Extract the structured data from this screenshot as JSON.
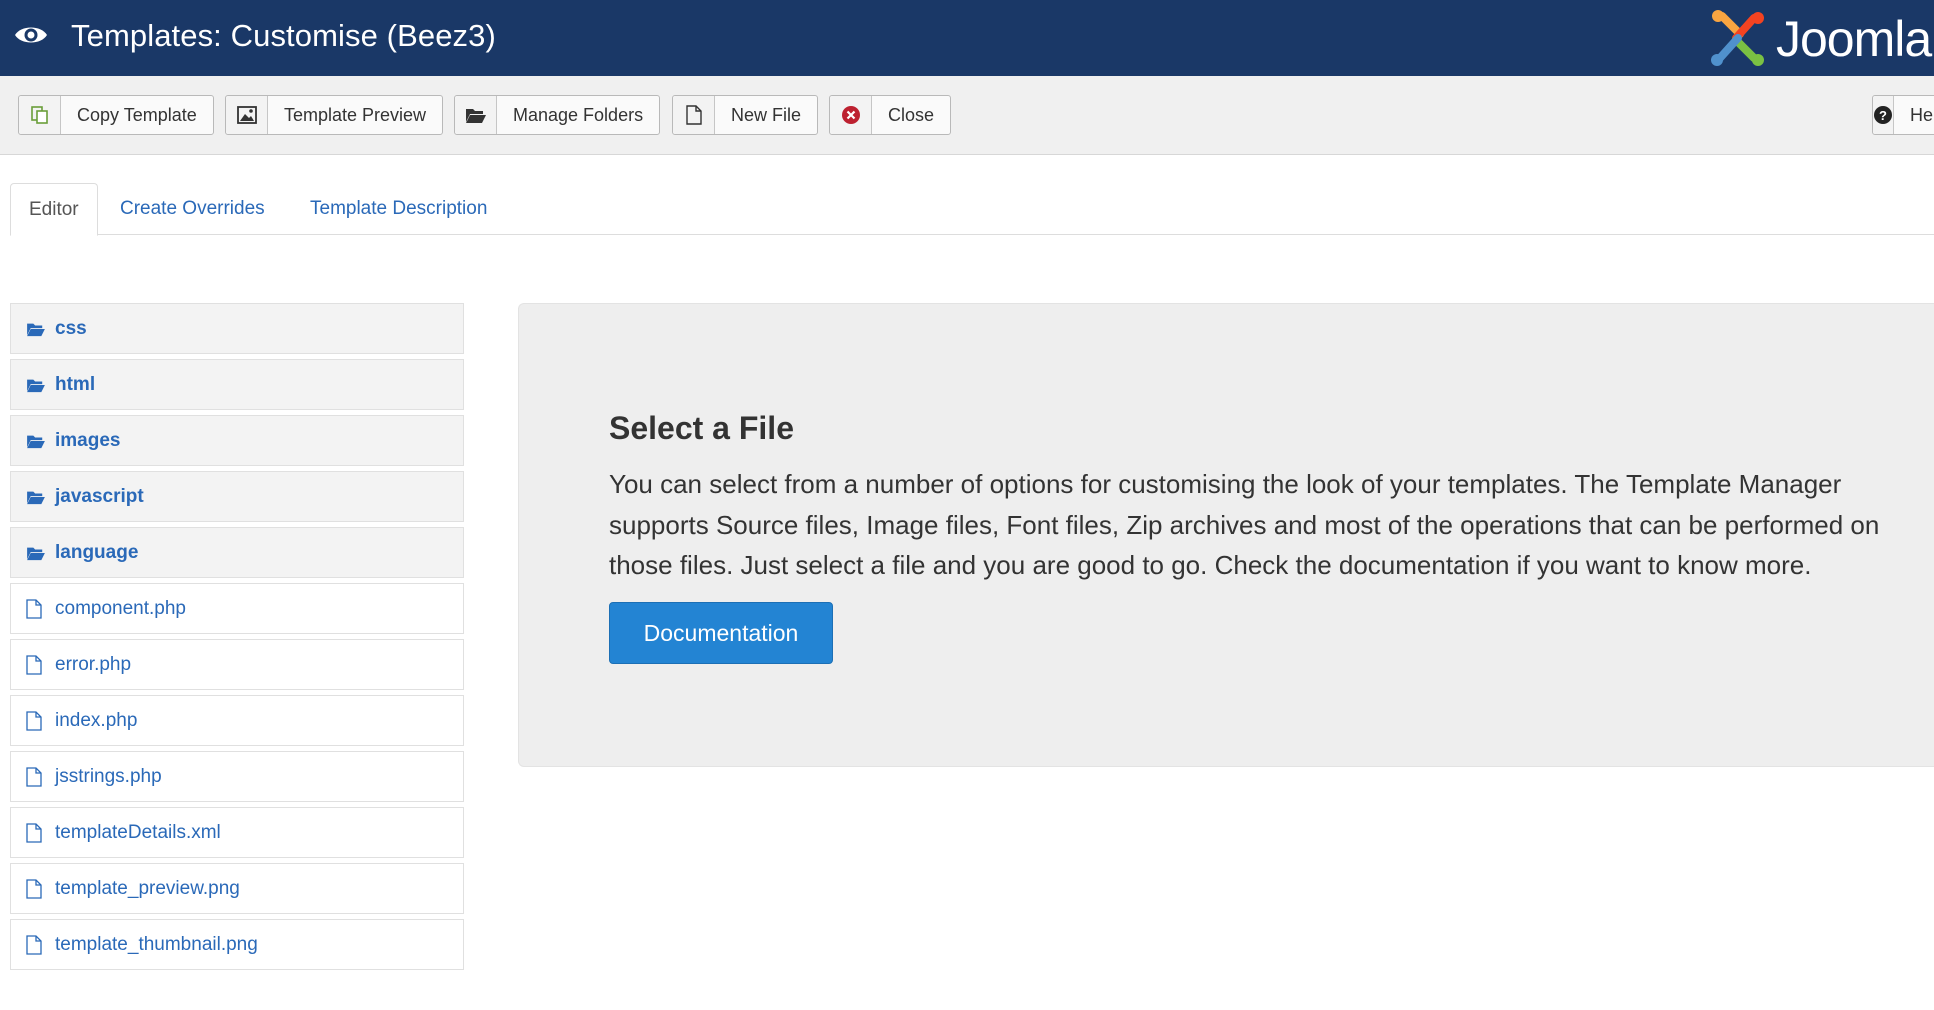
{
  "header": {
    "title": "Templates: Customise (Beez3)",
    "brand": "Joomla!",
    "brand_colors": [
      "#f9a541",
      "#f44321",
      "#5091cd",
      "#7ac143"
    ]
  },
  "toolbar": {
    "buttons": [
      {
        "label": "Copy Template",
        "icon": "copy-icon"
      },
      {
        "label": "Template Preview",
        "icon": "picture-icon"
      },
      {
        "label": "Manage Folders",
        "icon": "folder-open-icon"
      },
      {
        "label": "New File",
        "icon": "file-icon"
      },
      {
        "label": "Close",
        "icon": "close-circle-icon"
      }
    ],
    "help_label": "Help"
  },
  "tabs": [
    {
      "label": "Editor",
      "active": true
    },
    {
      "label": "Create Overrides",
      "active": false
    },
    {
      "label": "Template Description",
      "active": false
    }
  ],
  "tree": {
    "folders": [
      "css",
      "html",
      "images",
      "javascript",
      "language"
    ],
    "files": [
      "component.php",
      "error.php",
      "index.php",
      "jsstrings.php",
      "templateDetails.xml",
      "template_preview.png",
      "template_thumbnail.png"
    ]
  },
  "panel": {
    "title": "Select a File",
    "description": "You can select from a number of options for customising the look of your templates. The Template Manager supports Source files, Image files, Font files, Zip archives and most of the operations that can be performed on those files. Just select a file and you are good to go. Check the documentation if you want to know more.",
    "button_label": "Documentation"
  },
  "colors": {
    "header_bg": "#1a3867",
    "link": "#2a69b8",
    "primary_button": "#2384d3",
    "close_icon": "#bd2130"
  }
}
